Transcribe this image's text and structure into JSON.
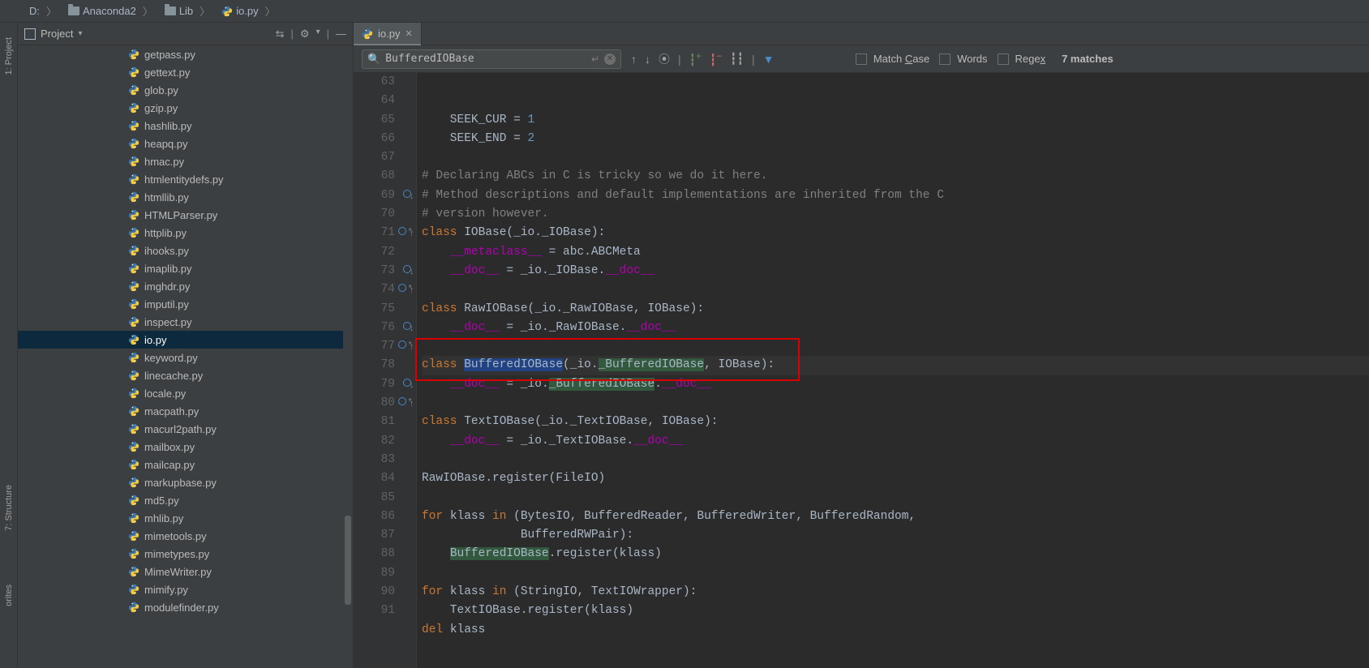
{
  "breadcrumb": [
    {
      "label": "D:",
      "icon": "none"
    },
    {
      "label": "Anaconda2",
      "icon": "folder"
    },
    {
      "label": "Lib",
      "icon": "folder"
    },
    {
      "label": "io.py",
      "icon": "python"
    }
  ],
  "projectPanel": {
    "title": "Project",
    "files": [
      "getpass.py",
      "gettext.py",
      "glob.py",
      "gzip.py",
      "hashlib.py",
      "heapq.py",
      "hmac.py",
      "htmlentitydefs.py",
      "htmllib.py",
      "HTMLParser.py",
      "httplib.py",
      "ihooks.py",
      "imaplib.py",
      "imghdr.py",
      "imputil.py",
      "inspect.py",
      "io.py",
      "keyword.py",
      "linecache.py",
      "locale.py",
      "macpath.py",
      "macurl2path.py",
      "mailbox.py",
      "mailcap.py",
      "markupbase.py",
      "md5.py",
      "mhlib.py",
      "mimetools.py",
      "mimetypes.py",
      "MimeWriter.py",
      "mimify.py",
      "modulefinder.py"
    ],
    "selected": "io.py"
  },
  "sideTabs": {
    "project": "1: Project",
    "structure": "7: Structure",
    "favorites": "orites"
  },
  "editorTabs": [
    {
      "label": "io.py"
    }
  ],
  "findBar": {
    "value": "BufferedIOBase",
    "matchCase": "Match Case",
    "words": "Words",
    "regex": "Regex",
    "matches": "7 matches"
  },
  "code": {
    "startLine": 63,
    "lines": [
      {
        "n": "",
        "g": "",
        "raw": "    SEEK_CUR = 1",
        "seg": [
          [
            "ident",
            "    SEEK_CUR = "
          ],
          [
            "num",
            "1"
          ]
        ]
      },
      {
        "n": 63,
        "g": "",
        "raw": "    SEEK_CUR = 1",
        "seg": [
          [
            "ident",
            "    SEEK_CUR = "
          ],
          [
            "num",
            "1"
          ]
        ]
      },
      {
        "n": 64,
        "g": "",
        "raw": "    SEEK_END = 2",
        "seg": [
          [
            "ident",
            "    SEEK_END = "
          ],
          [
            "num",
            "2"
          ]
        ]
      },
      {
        "n": 65,
        "g": "",
        "raw": "",
        "seg": []
      },
      {
        "n": 66,
        "g": "fold",
        "raw": "# Declaring ABCs in C is tricky so we do it here.",
        "seg": [
          [
            "comment",
            "# Declaring ABCs in C is tricky so we do it here."
          ]
        ]
      },
      {
        "n": 67,
        "g": "",
        "raw": "# Method descriptions and default implementations are inherited from the C",
        "seg": [
          [
            "comment",
            "# Method descriptions and default implementations are inherited from the C"
          ]
        ]
      },
      {
        "n": 68,
        "g": "foldend",
        "raw": "# version however.",
        "seg": [
          [
            "comment",
            "# version however."
          ]
        ]
      },
      {
        "n": 69,
        "g": "circle-down",
        "raw": "class IOBase(_io._IOBase):",
        "seg": [
          [
            "kw",
            "class "
          ],
          [
            "ident",
            "IOBase(_io._IOBase):"
          ]
        ]
      },
      {
        "n": 70,
        "g": "",
        "raw": "    __metaclass__ = abc.ABCMeta",
        "seg": [
          [
            "ident",
            "    "
          ],
          [
            "dunder",
            "__metaclass__"
          ],
          [
            "ident",
            " = abc.ABCMeta"
          ]
        ]
      },
      {
        "n": 71,
        "g": "star-circle-up",
        "raw": "    __doc__ = _io._IOBase.__doc__",
        "seg": [
          [
            "ident",
            "    "
          ],
          [
            "dunder",
            "__doc__"
          ],
          [
            "ident",
            " = _io._IOBase."
          ],
          [
            "dunder",
            "__doc__"
          ]
        ]
      },
      {
        "n": 72,
        "g": "",
        "raw": "",
        "seg": []
      },
      {
        "n": 73,
        "g": "circle-down",
        "raw": "class RawIOBase(_io._RawIOBase, IOBase):",
        "seg": [
          [
            "kw",
            "class "
          ],
          [
            "ident",
            "RawIOBase(_io._RawIOBase, IOBase):"
          ]
        ]
      },
      {
        "n": 74,
        "g": "star-circle-up",
        "raw": "    __doc__ = _io._RawIOBase.__doc__",
        "seg": [
          [
            "ident",
            "    "
          ],
          [
            "dunder",
            "__doc__"
          ],
          [
            "ident",
            " = _io._RawIOBase."
          ],
          [
            "dunder",
            "__doc__"
          ]
        ]
      },
      {
        "n": 75,
        "g": "",
        "raw": "",
        "seg": []
      },
      {
        "n": 76,
        "g": "circle-down",
        "cur": true,
        "raw": "class BufferedIOBase(_io._BufferedIOBase, IOBase):",
        "seg": [
          [
            "kw",
            "class "
          ],
          [
            "hl-sel",
            "BufferedIOBase"
          ],
          [
            "ident",
            "(_io."
          ],
          [
            "hl-search",
            "_BufferedIOBase"
          ],
          [
            "ident",
            ", IOBase):"
          ]
        ]
      },
      {
        "n": 77,
        "g": "star-circle-up",
        "raw": "    __doc__ = _io._BufferedIOBase.__doc__",
        "seg": [
          [
            "ident",
            "    "
          ],
          [
            "dunder",
            "__doc__"
          ],
          [
            "ident",
            " = _io."
          ],
          [
            "hl-search",
            "_BufferedIOBase"
          ],
          [
            "ident",
            "."
          ],
          [
            "dunder",
            "__doc__"
          ]
        ]
      },
      {
        "n": 78,
        "g": "",
        "raw": "",
        "seg": []
      },
      {
        "n": 79,
        "g": "circle-down",
        "raw": "class TextIOBase(_io._TextIOBase, IOBase):",
        "seg": [
          [
            "kw",
            "class "
          ],
          [
            "ident",
            "TextIOBase(_io._TextIOBase, IOBase):"
          ]
        ]
      },
      {
        "n": 80,
        "g": "star-circle-up",
        "raw": "    __doc__ = _io._TextIOBase.__doc__",
        "seg": [
          [
            "ident",
            "    "
          ],
          [
            "dunder",
            "__doc__"
          ],
          [
            "ident",
            " = _io._TextIOBase."
          ],
          [
            "dunder",
            "__doc__"
          ]
        ]
      },
      {
        "n": 81,
        "g": "",
        "raw": "",
        "seg": []
      },
      {
        "n": 82,
        "g": "",
        "raw": "RawIOBase.register(FileIO)",
        "seg": [
          [
            "ident",
            "RawIOBase.register(FileIO)"
          ]
        ]
      },
      {
        "n": 83,
        "g": "",
        "raw": "",
        "seg": []
      },
      {
        "n": 84,
        "g": "fold",
        "raw": "for klass in (BytesIO, BufferedReader, BufferedWriter, BufferedRandom,",
        "seg": [
          [
            "kw",
            "for "
          ],
          [
            "ident",
            "klass "
          ],
          [
            "kw",
            "in "
          ],
          [
            "ident",
            "(BytesIO, BufferedReader, BufferedWriter, BufferedRandom,"
          ]
        ]
      },
      {
        "n": 85,
        "g": "foldend",
        "raw": "              BufferedRWPair):",
        "seg": [
          [
            "ident",
            "              BufferedRWPair):"
          ]
        ]
      },
      {
        "n": 86,
        "g": "",
        "raw": "    BufferedIOBase.register(klass)",
        "seg": [
          [
            "ident",
            "    "
          ],
          [
            "hl-search",
            "BufferedIOBase"
          ],
          [
            "ident",
            ".register(klass)"
          ]
        ]
      },
      {
        "n": 87,
        "g": "",
        "raw": "",
        "seg": []
      },
      {
        "n": 88,
        "g": "",
        "raw": "for klass in (StringIO, TextIOWrapper):",
        "seg": [
          [
            "kw",
            "for "
          ],
          [
            "ident",
            "klass "
          ],
          [
            "kw",
            "in "
          ],
          [
            "ident",
            "(StringIO, TextIOWrapper):"
          ]
        ]
      },
      {
        "n": 89,
        "g": "",
        "raw": "    TextIOBase.register(klass)",
        "seg": [
          [
            "ident",
            "    TextIOBase.register(klass)"
          ]
        ]
      },
      {
        "n": 90,
        "g": "",
        "raw": "del klass",
        "seg": [
          [
            "kw",
            "del "
          ],
          [
            "ident",
            "klass"
          ]
        ]
      },
      {
        "n": 91,
        "g": "",
        "raw": "",
        "seg": []
      }
    ]
  },
  "redBox": {
    "comment": "highlight box drawn over lines 76-77"
  }
}
